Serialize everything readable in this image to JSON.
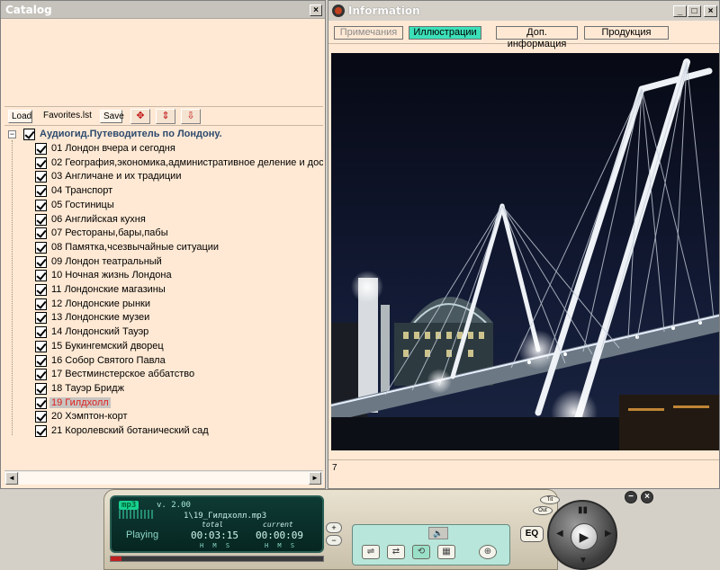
{
  "catalog": {
    "title": "Catalog",
    "close": "×",
    "toolbar": {
      "load_label": "Load",
      "file_name": "Favorites.lst",
      "save_label": "Save",
      "move_icon": "✥",
      "up_icon": "⇕",
      "down_icon": "⇩"
    },
    "tree": {
      "expander": "−",
      "root": "Аудиогид.Путеводитель по Лондону.",
      "items": [
        "01 Лондон вчера и сегодня",
        "02 География,экономика,административное деление и дост",
        "03 Англичане и их традиции",
        "04 Транспорт",
        "05 Гостиницы",
        "06 Английская кухня",
        "07 Рестораны,бары,пабы",
        "08 Памятка,чсезвычайные ситуации",
        "09 Лондон театральный",
        "10 Ночная жизнь Лондона",
        "11 Лондонские магазины",
        "12 Лондонские рынки",
        "13 Лондонские музеи",
        "14 Лондонский Тауэр",
        "15 Букингемский дворец",
        "16 Собор Святого Павла",
        "17 Вестминстерское аббатство",
        "18 Тауэр Бридж",
        "19 Гилдхолл",
        "20 Хэмптон-корт",
        "21 Королевский ботанический сад"
      ],
      "selected_index": 18
    },
    "scroll_left": "◄",
    "scroll_right": "►"
  },
  "info": {
    "title": "Information",
    "buttons": {
      "min": "_",
      "max": "□",
      "close": "×"
    },
    "tabs": [
      "Примечания",
      "Иллюстрации",
      "Доп. информация",
      "Продукция"
    ],
    "active_tab": 1,
    "status": "7"
  },
  "player": {
    "logo": "mp3",
    "version": "v. 2.00",
    "file": "1\\19_Гилдхолл.mp3",
    "state": "Playing",
    "total_label": "total",
    "current_label": "current",
    "total": "00:03:15",
    "current": "00:00:09",
    "hms": "H M S",
    "vol_up": "+",
    "vol_down": "−",
    "eq": "EQ",
    "play": "▶",
    "min": "−",
    "close": "×",
    "progress_percent": 5,
    "mute": "🔈",
    "mode_icons": [
      "⇌",
      "⇄",
      "⟲",
      "▦",
      "⊕"
    ],
    "ovals": [
      "Tit",
      "Out"
    ]
  },
  "colors": {
    "panel_bg": "#ffe9d4",
    "active_tab": "#3ce0b8",
    "selected_item": "#e02020",
    "display_bg": "#0f3a34"
  }
}
